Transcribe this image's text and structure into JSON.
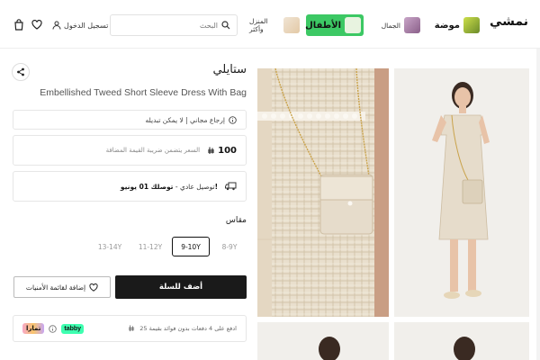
{
  "header": {
    "brand": "نمشي",
    "categories": [
      {
        "label": "موضة",
        "icon": "fashion-thumbnail"
      },
      {
        "label": "الجمال",
        "icon": "beauty-thumbnail"
      },
      {
        "label": "الأطفال",
        "icon": "kids-thumbnail",
        "accent": "#3cc864"
      },
      {
        "label": "المنزل وأكثر",
        "icon": "home-thumbnail"
      }
    ],
    "search_placeholder": "البحث",
    "login_label": "تسجيل الدخول"
  },
  "product": {
    "brand": "ستايلي",
    "name": "Embellished Tweed Short Sleeve Dress With Bag",
    "return_policy": "إرجاع مجاني | لا يمكن تبديله",
    "price": "100",
    "price_note": "السعر يتضمن ضريبة القيمة المضافة",
    "shipping_prefix": "توصيل عادي - ",
    "shipping_date": "توصلك 01 يونيو!",
    "size_label": "مقاس",
    "sizes": [
      {
        "label": "8-9Y",
        "selected": false
      },
      {
        "label": "9-10Y",
        "selected": true
      },
      {
        "label": "11-12Y",
        "selected": false
      },
      {
        "label": "13-14Y",
        "selected": false
      }
    ],
    "add_to_cart": "أضف للسلة",
    "add_to_wishlist": "إضافة لقائمة الأمنيات",
    "installments": "ادفع على 4 دفعات بدون فوائد بقيمة 25",
    "bnpl": [
      "tabby",
      "تمارا"
    ]
  },
  "colors": {
    "primary": "#1a1a1a",
    "kids_accent": "#3cc864",
    "tabby": "#3effb0"
  }
}
